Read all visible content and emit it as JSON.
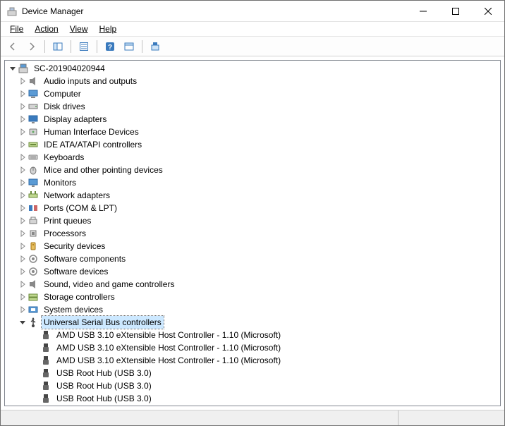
{
  "window": {
    "title": "Device Manager"
  },
  "menu": {
    "file": "File",
    "action": "Action",
    "view": "View",
    "help": "Help"
  },
  "tree": {
    "root": "SC-201904020944",
    "categories": [
      {
        "label": "Audio inputs and outputs",
        "icon": "audio",
        "expanded": false
      },
      {
        "label": "Computer",
        "icon": "computer",
        "expanded": false
      },
      {
        "label": "Disk drives",
        "icon": "disk",
        "expanded": false
      },
      {
        "label": "Display adapters",
        "icon": "display",
        "expanded": false
      },
      {
        "label": "Human Interface Devices",
        "icon": "hid",
        "expanded": false
      },
      {
        "label": "IDE ATA/ATAPI controllers",
        "icon": "ide",
        "expanded": false
      },
      {
        "label": "Keyboards",
        "icon": "keyboard",
        "expanded": false
      },
      {
        "label": "Mice and other pointing devices",
        "icon": "mouse",
        "expanded": false
      },
      {
        "label": "Monitors",
        "icon": "monitor",
        "expanded": false
      },
      {
        "label": "Network adapters",
        "icon": "network",
        "expanded": false
      },
      {
        "label": "Ports (COM & LPT)",
        "icon": "ports",
        "expanded": false
      },
      {
        "label": "Print queues",
        "icon": "printer",
        "expanded": false
      },
      {
        "label": "Processors",
        "icon": "processor",
        "expanded": false
      },
      {
        "label": "Security devices",
        "icon": "security",
        "expanded": false
      },
      {
        "label": "Software components",
        "icon": "software",
        "expanded": false
      },
      {
        "label": "Software devices",
        "icon": "software",
        "expanded": false
      },
      {
        "label": "Sound, video and game controllers",
        "icon": "audio",
        "expanded": false
      },
      {
        "label": "Storage controllers",
        "icon": "storage",
        "expanded": false
      },
      {
        "label": "System devices",
        "icon": "system",
        "expanded": false
      },
      {
        "label": "Universal Serial Bus controllers",
        "icon": "usb",
        "expanded": true,
        "selected": true,
        "children": [
          {
            "label": "AMD USB 3.10 eXtensible Host Controller - 1.10 (Microsoft)"
          },
          {
            "label": "AMD USB 3.10 eXtensible Host Controller - 1.10 (Microsoft)"
          },
          {
            "label": "AMD USB 3.10 eXtensible Host Controller - 1.10 (Microsoft)"
          },
          {
            "label": "USB Root Hub (USB 3.0)"
          },
          {
            "label": "USB Root Hub (USB 3.0)"
          },
          {
            "label": "USB Root Hub (USB 3.0)"
          }
        ]
      }
    ]
  }
}
